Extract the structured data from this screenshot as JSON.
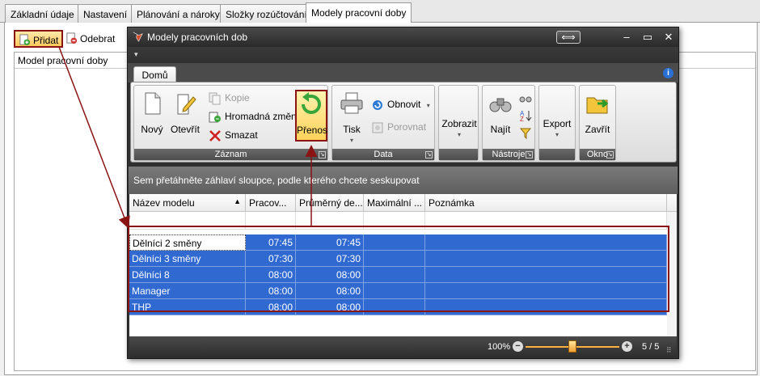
{
  "bg_app": {
    "tabs": [
      "Základní údaje",
      "Nastavení",
      "Plánování a nároky",
      "Složky rozúčtování",
      "Modely pracovní doby"
    ],
    "toolbar": {
      "add_label": "Přidat",
      "remove_label": "Odebrat"
    },
    "list_header": "Model pracovní doby"
  },
  "dialog": {
    "title": "Modely pracovních dob",
    "ribbon_tab": "Domů",
    "groups": {
      "zaznam": {
        "label": "Záznam",
        "new": "Nový",
        "open": "Otevřít",
        "copy": "Kopie",
        "bulk_change": "Hromadná změna",
        "delete": "Smazat",
        "transfer": "Přenos"
      },
      "data": {
        "label": "Data",
        "print": "Tisk",
        "refresh": "Obnovit",
        "compare": "Porovnat"
      },
      "view": {
        "show": "Zobrazit"
      },
      "tools": {
        "label": "Nástroje",
        "find": "Najít"
      },
      "export": {
        "export": "Export"
      },
      "window": {
        "label": "Okno",
        "close": "Zavřít"
      }
    },
    "group_panel_hint": "Sem přetáhněte záhlaví sloupce, podle kterého chcete seskupovat",
    "grid": {
      "columns": [
        "Název modelu",
        "Pracov...",
        "Průměrný de...",
        "Maximální ...",
        "Poznámka"
      ],
      "rows": [
        [
          "Dělníci 2 směny",
          "07:45",
          "07:45",
          "",
          ""
        ],
        [
          "Dělníci 3 směny",
          "07:30",
          "07:30",
          "",
          ""
        ],
        [
          "Dělníci 8",
          "08:00",
          "08:00",
          "",
          ""
        ],
        [
          "Manager",
          "08:00",
          "08:00",
          "",
          ""
        ],
        [
          "THP",
          "08:00",
          "08:00",
          "",
          ""
        ]
      ]
    },
    "status": {
      "zoom": "100%",
      "zoom_level": 0.5,
      "pages": "5 / 5"
    }
  },
  "colors": {
    "highlight_border": "#8a1414",
    "selection": "#3069d0",
    "ribbon_dark": "#4d4d4d"
  }
}
